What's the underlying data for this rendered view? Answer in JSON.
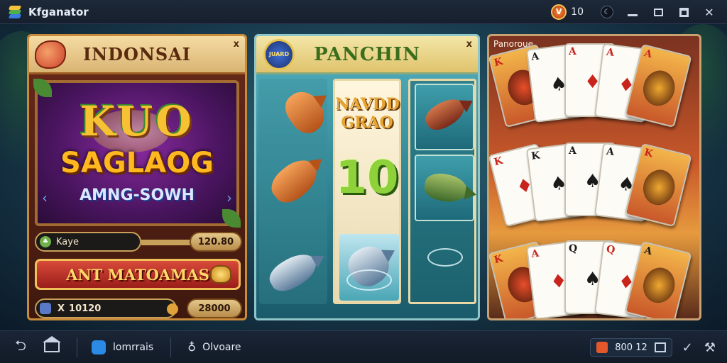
{
  "window": {
    "title": "Kfganator",
    "coin_glyph": "V",
    "coin_count": "10",
    "moon_glyph": "☾",
    "close_glyph": "✕"
  },
  "panels": {
    "left": {
      "title": "INDONSAI",
      "close": "x",
      "logo_line1": "KUO",
      "logo_line2": "SAGLAOG",
      "logo_line3": "AMNG-SOWH",
      "arrow_left": "‹",
      "arrow_right": "›",
      "kaye_icon": "♣",
      "kaye_label": "Kaye",
      "kaye_value": "120.80",
      "action_button": "ANT MATOAMAS",
      "coins_label": "10120",
      "coins_prefix": "X",
      "score_value": "28000"
    },
    "middle": {
      "title": "PANCHIN",
      "close": "x",
      "badge_text": "JUARD",
      "bonus_label": "NAVDD GRAO",
      "bonus_number": "10"
    },
    "right": {
      "label": "Panoroue",
      "cards": [
        {
          "rank": "K",
          "suit": "♦",
          "color": "red",
          "art": true
        },
        {
          "rank": "A",
          "suit": "♠",
          "color": "black",
          "art": false
        },
        {
          "rank": "A",
          "suit": "♦",
          "color": "red",
          "art": false
        },
        {
          "rank": "A",
          "suit": "♦",
          "color": "red",
          "art": false
        },
        {
          "rank": "A",
          "suit": "♥",
          "color": "red",
          "art": true
        },
        {
          "rank": "K",
          "suit": "♦",
          "color": "red",
          "art": false
        },
        {
          "rank": "K",
          "suit": "♠",
          "color": "black",
          "art": false
        },
        {
          "rank": "A",
          "suit": "♠",
          "color": "black",
          "art": false
        },
        {
          "rank": "A",
          "suit": "♠",
          "color": "black",
          "art": false
        },
        {
          "rank": "K",
          "suit": "♦",
          "color": "red",
          "art": true
        },
        {
          "rank": "K",
          "suit": "♦",
          "color": "red",
          "art": true
        },
        {
          "rank": "A",
          "suit": "♦",
          "color": "red",
          "art": false
        },
        {
          "rank": "Q",
          "suit": "♠",
          "color": "black",
          "art": false
        },
        {
          "rank": "Q",
          "suit": "♦",
          "color": "red",
          "art": false
        },
        {
          "rank": "A",
          "suit": "♠",
          "color": "black",
          "art": true
        }
      ]
    }
  },
  "navbar": {
    "back_glyph": "⮌",
    "task1_label": "lomrrais",
    "task2_glyph": "♁",
    "task2_label": "Olvoare",
    "status_text": "800 12",
    "tool1_glyph": "✓",
    "tool2_glyph": "⚒"
  },
  "colors": {
    "accent_gold": "#f6c233",
    "brand_blue": "#2a8ae6"
  }
}
